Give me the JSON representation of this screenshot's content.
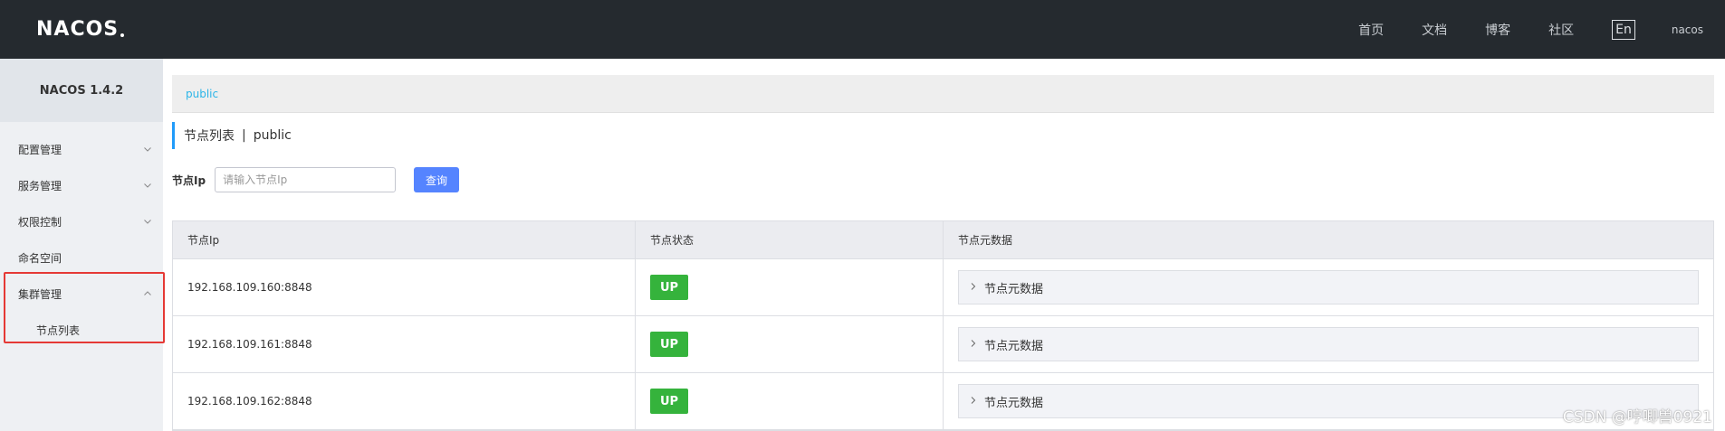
{
  "header": {
    "logo": "NACOS",
    "nav": [
      "首页",
      "文档",
      "博客",
      "社区"
    ],
    "lang": "En",
    "user": "nacos"
  },
  "sidebar": {
    "title": "NACOS 1.4.2",
    "items": [
      {
        "label": "配置管理",
        "icon": "chevron-down-icon"
      },
      {
        "label": "服务管理",
        "icon": "chevron-down-icon"
      },
      {
        "label": "权限控制",
        "icon": "chevron-down-icon"
      },
      {
        "label": "命名空间",
        "icon": ""
      },
      {
        "label": "集群管理",
        "icon": "chevron-up-icon"
      }
    ],
    "subitems": [
      {
        "label": "节点列表"
      }
    ]
  },
  "main": {
    "namespace_tab": "public",
    "title_main": "节点列表",
    "title_sep": "|",
    "title_ns": "public",
    "search": {
      "label": "节点Ip",
      "placeholder": "请输入节点Ip",
      "value": "",
      "button": "查询"
    },
    "table": {
      "columns": [
        "节点Ip",
        "节点状态",
        "节点元数据"
      ],
      "rows": [
        {
          "ip": "192.168.109.160:8848",
          "status": "UP",
          "meta": "节点元数据"
        },
        {
          "ip": "192.168.109.161:8848",
          "status": "UP",
          "meta": "节点元数据"
        },
        {
          "ip": "192.168.109.162:8848",
          "status": "UP",
          "meta": "节点元数据"
        }
      ]
    }
  },
  "watermark": "CSDN @哼唧兽0921",
  "colors": {
    "header_bg": "#252a2f",
    "accent": "#5584ff",
    "status_up": "#35b33c",
    "highlight": "#e53935"
  }
}
